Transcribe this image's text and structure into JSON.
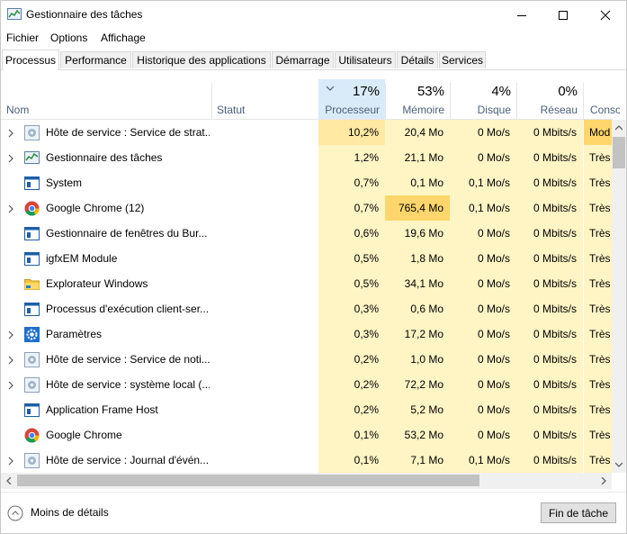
{
  "window": {
    "title": "Gestionnaire des tâches"
  },
  "menu": [
    "Fichier",
    "Options",
    "Affichage"
  ],
  "tabs": [
    "Processus",
    "Performance",
    "Historique des applications",
    "Démarrage",
    "Utilisateurs",
    "Détails",
    "Services"
  ],
  "active_tab": "Processus",
  "columns": {
    "name": {
      "label": "Nom"
    },
    "status": {
      "label": "Statut"
    },
    "cpu": {
      "label": "Processeur",
      "pct": "17%"
    },
    "memory": {
      "label": "Mémoire",
      "pct": "53%"
    },
    "disk": {
      "label": "Disque",
      "pct": "4%"
    },
    "network": {
      "label": "Réseau",
      "pct": "0%"
    },
    "power": {
      "label": "Consor"
    }
  },
  "processes": [
    {
      "expandable": true,
      "icon": "service-gear-icon",
      "name": "Hôte de service : Service de strat...",
      "cpu": "10,2%",
      "mem": "20,4 Mo",
      "disk": "0 Mo/s",
      "net": "0 Mbits/s",
      "power": "Mod"
    },
    {
      "expandable": true,
      "icon": "task-manager-icon",
      "name": "Gestionnaire des tâches",
      "cpu": "1,2%",
      "mem": "21,1 Mo",
      "disk": "0 Mo/s",
      "net": "0 Mbits/s",
      "power": "Très f"
    },
    {
      "expandable": false,
      "icon": "window-app-icon",
      "name": "System",
      "cpu": "0,7%",
      "mem": "0,1 Mo",
      "disk": "0,1 Mo/s",
      "net": "0 Mbits/s",
      "power": "Très f"
    },
    {
      "expandable": true,
      "icon": "chrome-icon",
      "name": "Google Chrome (12)",
      "cpu": "0,7%",
      "mem": "765,4 Mo",
      "disk": "0,1 Mo/s",
      "net": "0 Mbits/s",
      "power": "Très f"
    },
    {
      "expandable": false,
      "icon": "window-app-icon",
      "name": "Gestionnaire de fenêtres du Bur...",
      "cpu": "0,6%",
      "mem": "19,6 Mo",
      "disk": "0 Mo/s",
      "net": "0 Mbits/s",
      "power": "Très f"
    },
    {
      "expandable": false,
      "icon": "window-app-icon",
      "name": "igfxEM Module",
      "cpu": "0,5%",
      "mem": "1,8 Mo",
      "disk": "0 Mo/s",
      "net": "0 Mbits/s",
      "power": "Très f"
    },
    {
      "expandable": false,
      "icon": "folder-icon",
      "name": "Explorateur Windows",
      "cpu": "0,5%",
      "mem": "34,1 Mo",
      "disk": "0 Mo/s",
      "net": "0 Mbits/s",
      "power": "Très f"
    },
    {
      "expandable": false,
      "icon": "window-app-icon",
      "name": "Processus d'exécution client-ser...",
      "cpu": "0,3%",
      "mem": "0,6 Mo",
      "disk": "0 Mo/s",
      "net": "0 Mbits/s",
      "power": "Très f"
    },
    {
      "expandable": true,
      "icon": "settings-gear-icon",
      "name": "Paramètres",
      "cpu": "0,3%",
      "mem": "17,2 Mo",
      "disk": "0 Mo/s",
      "net": "0 Mbits/s",
      "power": "Très f"
    },
    {
      "expandable": true,
      "icon": "service-gear-icon",
      "name": "Hôte de service : Service de noti...",
      "cpu": "0,2%",
      "mem": "1,0 Mo",
      "disk": "0 Mo/s",
      "net": "0 Mbits/s",
      "power": "Très f"
    },
    {
      "expandable": true,
      "icon": "service-gear-icon",
      "name": "Hôte de service : système local (...",
      "cpu": "0,2%",
      "mem": "72,2 Mo",
      "disk": "0 Mo/s",
      "net": "0 Mbits/s",
      "power": "Très f"
    },
    {
      "expandable": false,
      "icon": "window-app-icon",
      "name": "Application Frame Host",
      "cpu": "0,2%",
      "mem": "5,2 Mo",
      "disk": "0 Mo/s",
      "net": "0 Mbits/s",
      "power": "Très f"
    },
    {
      "expandable": false,
      "icon": "chrome-icon",
      "name": "Google Chrome",
      "cpu": "0,1%",
      "mem": "53,2 Mo",
      "disk": "0 Mo/s",
      "net": "0 Mbits/s",
      "power": "Très f"
    },
    {
      "expandable": true,
      "icon": "service-gear-icon",
      "name": "Hôte de service : Journal d'évén...",
      "cpu": "0,1%",
      "mem": "7,1 Mo",
      "disk": "0,1 Mo/s",
      "net": "0 Mbits/s",
      "power": "Très f"
    }
  ],
  "footer": {
    "less_details": "Moins de détails",
    "end_task": "Fin de tâche"
  },
  "colors": {
    "heat_light": "#fff4c4",
    "heat_medium": "#ffe9a3",
    "heat_strong": "#ffd66b",
    "header_selected": "#d9ebf9",
    "header_label": "#4c607a"
  }
}
